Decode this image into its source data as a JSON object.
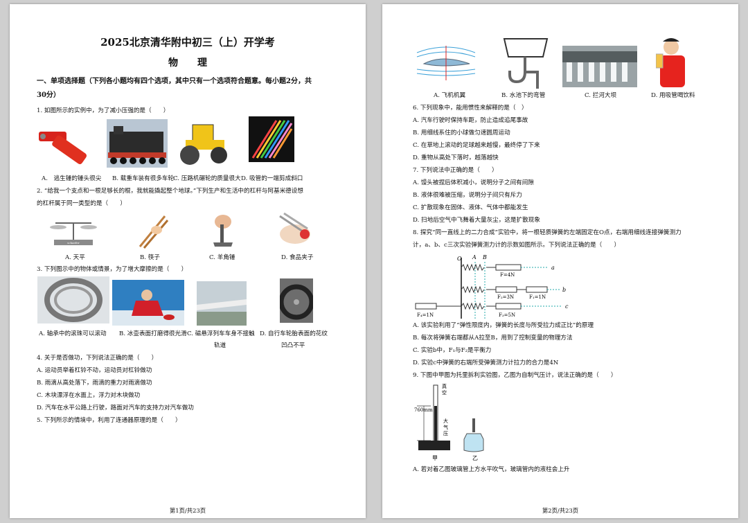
{
  "page1": {
    "title": "2025北京清华附中初三（上）开学考",
    "subject": "物　　理",
    "section1_line1": "一、单项选择题（下列各小题均有四个选项，其中只有一个选项符合题意。每小题2分，共",
    "section1_line2": "30分）",
    "q1": "1. 如图所示的实例中，为了减小压强的是（　　）",
    "q1_options": [
      "A.　逃生锤的锤头很尖",
      "B. 载重车装有很多车轮",
      "C. 压路机碾轮的质量很大",
      "D. 吸管的一端剪成斜口"
    ],
    "q2_line1": "2. “给我一个支点和一根足够长的棍，我就能撬起整个地球。”下列生产和生活中的杠杆与阿基米德设想",
    "q2_line2": "的杠杆属于同一类型的是（　　）",
    "q2_options": [
      "A. 天平",
      "B. 筷子",
      "C. 羊角锤",
      "D. 食品夹子"
    ],
    "scale_label": "schaefer",
    "q3": "3. 下列图示中的物体或情景，为了增大摩擦的是（　　）",
    "q3_options": [
      "A. 轴承中的滚珠可以滚动",
      "B. 冰壶表面打磨得很光滑",
      "C. 磁悬浮列车车身不接触",
      "D. 自行车轮胎表面的花纹"
    ],
    "q3_options_line2": [
      "轨道",
      "凹凸不平"
    ],
    "q4": "4. 关于是否做功，下列说法正确的是（　　）",
    "q4_options": [
      "A. 运动员举着杠铃不动，运动员对杠铃做功",
      "B. 雨滴从高处落下，雨滴的重力对雨滴做功",
      "C. 木块漂浮在水面上，浮力对木块做功",
      "D. 汽车在水平公路上行驶，路面对汽车的支持力对汽车做功"
    ],
    "q5": "5. 下列所示的情境中，利用了连通器原理的是（　　）",
    "footer": "第1页/共23页"
  },
  "page2": {
    "q5_options": [
      "A. 飞机机翼",
      "B. 水池下的弯管",
      "C. 拦河大坝",
      "D. 用吸管喝饮料"
    ],
    "q6": "6. 下列现象中，能用惯性来解释的是（　）",
    "q6_options": [
      "A. 汽车行驶时保持车距，防止造成追尾事故",
      "B. 用细线系住的小球做匀速圆周运动",
      "C. 在草地上滚动的足球越来越慢，最终停了下来",
      "D. 重物从高处下落时，越落越快"
    ],
    "q7": "7. 下列说法中正确的是（　　）",
    "q7_options": [
      "A. 馒头被捏后体积减小，说明分子之间有间隙",
      "B. 液体很难被压缩，说明分子间只有斥力",
      "C. 扩散现象在固体、液体、气体中都能发生",
      "D. 扫地后空气中飞舞着大量灰尘，这是扩散现象"
    ],
    "q8_line1": "8. 探究“同一直线上的二力合成”实验中，将一根轻质弹簧的左端固定在O点，右端用细线连接弹簧测力",
    "q8_line2": "计，a、b、c三次实验弹簧测力计的示数如图所示。下列说法正确的是（　　）",
    "q8_fig": {
      "O": "O",
      "A": "A",
      "B": "B",
      "a": "a",
      "b": "b",
      "c": "c",
      "F": "F=4N",
      "F2": "F₂=3N",
      "F1": "F₁=1N",
      "F4": "F₄=1N",
      "F3": "F₃=5N"
    },
    "q8_options": [
      "A. 该实验利用了“弹性限度内，弹簧的长度与所受拉力成正比”的原理",
      "B. 每次将弹簧右端都从A拉至B，用到了控制变量的物理方法",
      "C. 实验b中，F₁与F₂是平衡力",
      "D. 实验c中弹簧的右端所受弹簧测力计拉力的合力是4N"
    ],
    "q9": "9. 下图中甲图为托里拆利实验图，乙图为自制气压计，说法正确的是（　　）",
    "q9_fig": {
      "vacuum1": "真",
      "vacuum2": "空",
      "height": "760mm",
      "air1": "大",
      "air2": "气",
      "air3": "压",
      "jia": "甲",
      "yi": "乙"
    },
    "q9_optionA": "A. 若对着乙图玻璃管上方水平吹气，玻璃管内的液柱会上升",
    "footer": "第2页/共23页"
  }
}
